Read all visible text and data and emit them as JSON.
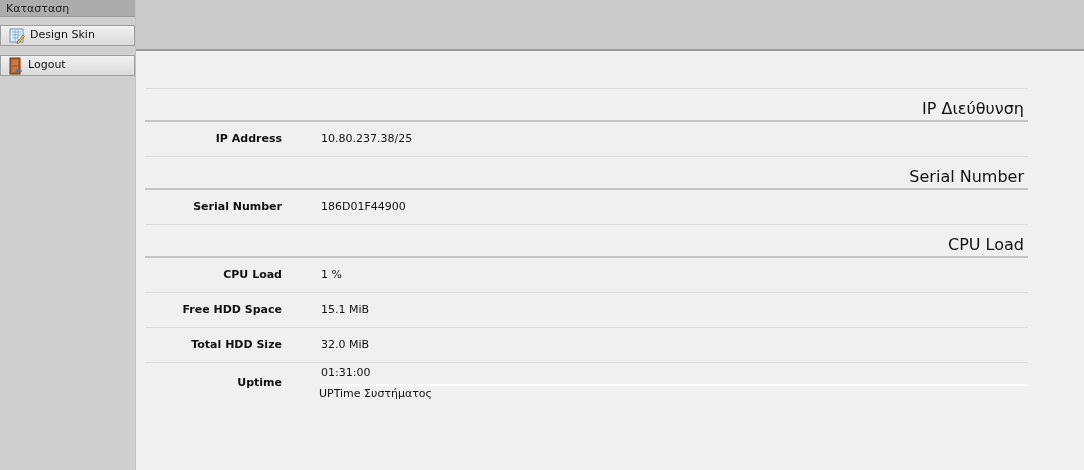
{
  "sidebar": {
    "header": "Κατασταση",
    "items": [
      {
        "label": "Design Skin",
        "kind": "design"
      },
      {
        "label": "Logout",
        "kind": "door"
      }
    ]
  },
  "sections": [
    {
      "title": "IP Διεύθυνση",
      "rows": [
        {
          "label": "IP Address",
          "value": "10.80.237.38/25"
        }
      ]
    },
    {
      "title": "Serial Number",
      "rows": [
        {
          "label": "Serial Number",
          "value": "186D01F44900"
        }
      ]
    },
    {
      "title": "CPU Load",
      "rows": [
        {
          "label": "CPU Load",
          "value": "1 %"
        },
        {
          "label": "Free HDD Space",
          "value": "15.1 MiB"
        },
        {
          "label": "Total HDD Size",
          "value": "32.0 MiB"
        },
        {
          "label": "Uptime",
          "value": "01:31:00",
          "note": "UPTime Συστήματος"
        }
      ]
    }
  ]
}
